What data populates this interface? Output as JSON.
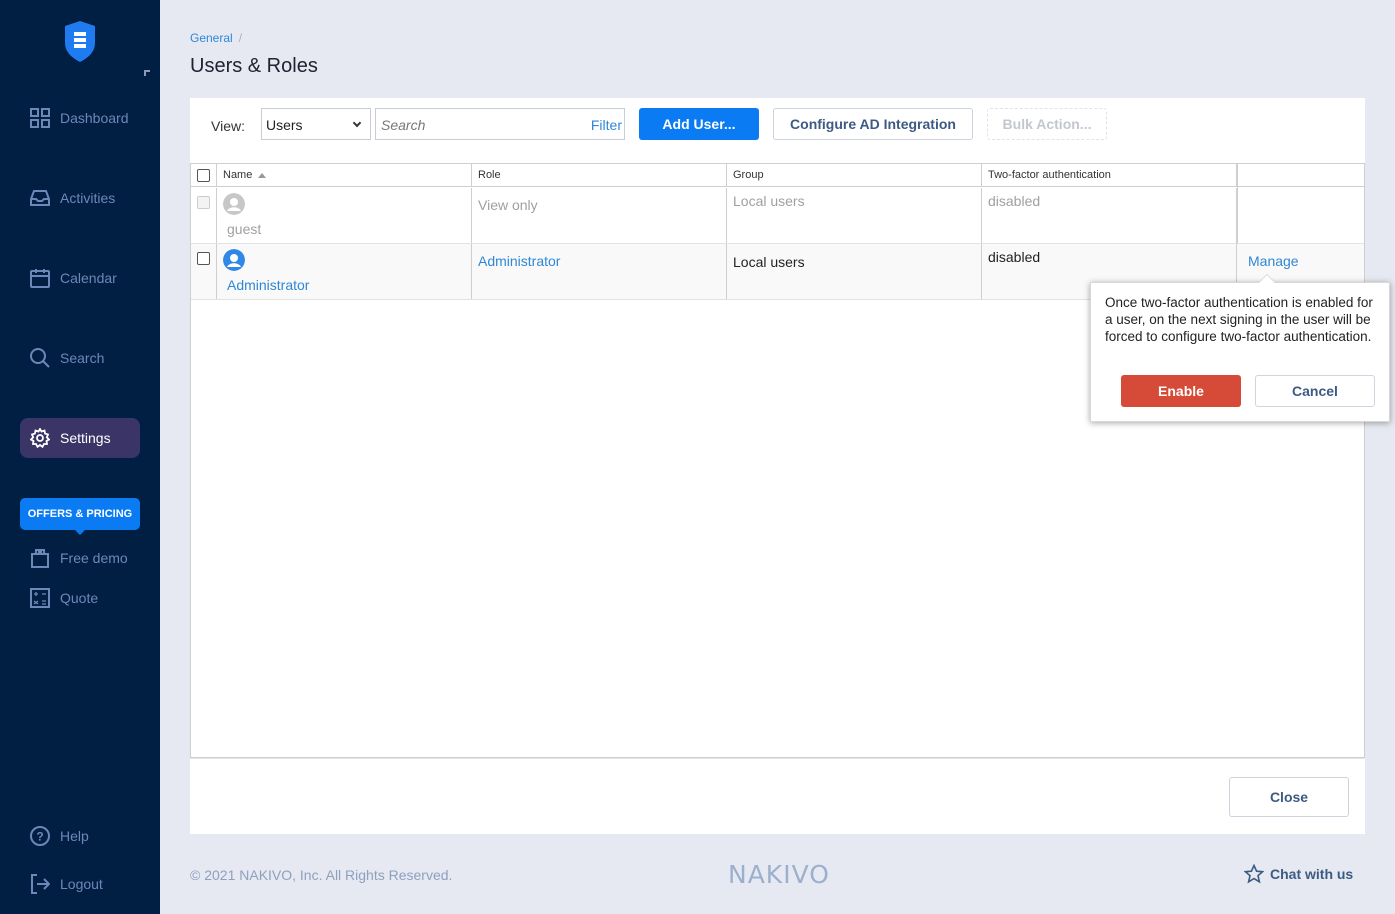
{
  "sidebar": {
    "items": [
      {
        "label": "Dashboard",
        "icon": "grid-icon"
      },
      {
        "label": "Activities",
        "icon": "inbox-icon"
      },
      {
        "label": "Calendar",
        "icon": "calendar-icon"
      },
      {
        "label": "Search",
        "icon": "search-icon"
      },
      {
        "label": "Settings",
        "icon": "gear-icon",
        "active": true
      }
    ],
    "offers_label": "OFFERS & PRICING",
    "extra_items": [
      {
        "label": "Free demo",
        "icon": "gift-icon"
      },
      {
        "label": "Quote",
        "icon": "calculator-icon"
      }
    ],
    "bottom_items": [
      {
        "label": "Help",
        "icon": "help-icon"
      },
      {
        "label": "Logout",
        "icon": "logout-icon"
      }
    ]
  },
  "header": {
    "breadcrumb": "General",
    "breadcrumb_sep": "/",
    "title": "Users & Roles"
  },
  "toolbar": {
    "view_label": "View:",
    "view_value": "Users",
    "search_placeholder": "Search",
    "filter_label": "Filter",
    "add_user": "Add User...",
    "configure_ad": "Configure AD Integration",
    "bulk_action": "Bulk Action..."
  },
  "table": {
    "columns": [
      "Name",
      "Role",
      "Group",
      "Two-factor authentication",
      ""
    ],
    "rows": [
      {
        "name": "guest",
        "role": "View only",
        "group": "Local users",
        "tfa": "disabled",
        "action": ""
      },
      {
        "name": "Administrator",
        "role": "Administrator",
        "group": "Local users",
        "tfa": "disabled",
        "action": "Manage"
      }
    ]
  },
  "popover": {
    "text": "Once two-factor authentication is enabled for a user, on the next signing in the user will be forced to configure two-factor authentication.",
    "enable": "Enable",
    "cancel": "Cancel"
  },
  "panel": {
    "close": "Close"
  },
  "footer": {
    "copyright": "© 2021 NAKIVO, Inc. All Rights Reserved.",
    "brand": "NAKIVO",
    "chat": "Chat with us"
  },
  "colors": {
    "sidebar_bg": "#011f43",
    "accent": "#0a7bf2",
    "danger": "#d64a38",
    "link": "#2f87d5"
  }
}
